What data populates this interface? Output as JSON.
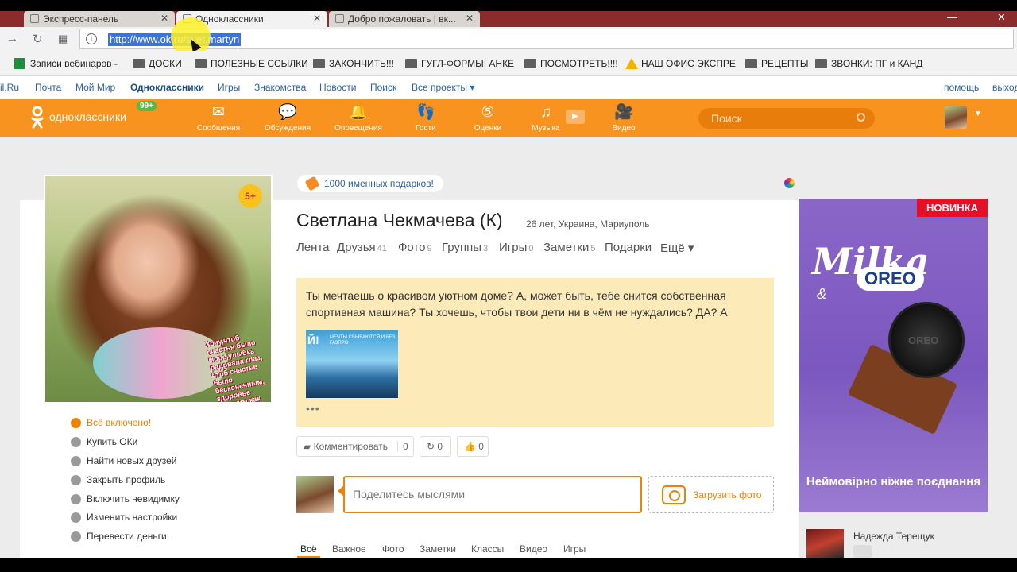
{
  "browser": {
    "tabs": [
      {
        "title": "Экспресс-панель"
      },
      {
        "title": "Одноклассники"
      },
      {
        "title": "Добро пожаловать | вк..."
      }
    ],
    "url": "http://www.ok.ru/svet.martyn",
    "bookmarks": [
      "Записи вебинаров -",
      "ДОСКИ",
      "ПОЛЕЗНЫЕ ССЫЛКИ",
      "ЗАКОНЧИТЬ!!!",
      "ГУГЛ-ФОРМЫ: АНКЕ",
      "ПОСМОТРЕТЬ!!!!",
      "НАШ ОФИС ЭКСПРЕ",
      "РЕЦЕПТЫ",
      "ЗВОНКИ: ПГ и КАНД"
    ]
  },
  "site_nav": {
    "items": [
      "il.Ru",
      "Почта",
      "Мой Мир",
      "Одноклассники",
      "Игры",
      "Знакомства",
      "Новости",
      "Поиск",
      "Все проекты ▾"
    ],
    "help": "помощь",
    "exit": "выход"
  },
  "header": {
    "logo": "одноклассники",
    "badge": "99+",
    "items": [
      {
        "label": "Сообщения",
        "icon": "envelope-icon"
      },
      {
        "label": "Обсуждения",
        "icon": "chat-bubbles-icon"
      },
      {
        "label": "Оповещения",
        "icon": "bell-icon"
      },
      {
        "label": "Гости",
        "icon": "footprints-icon"
      },
      {
        "label": "Оценки",
        "icon": "rating-5-icon"
      },
      {
        "label": "Музыка",
        "icon": "music-note-icon"
      },
      {
        "label": "Видео",
        "icon": "video-camera-icon"
      }
    ],
    "search_placeholder": "Поиск"
  },
  "profile": {
    "age_badge": "5+",
    "photo_poem": "Хочу,чтоб счастья было море,улыбка радовала глаз, чтоб счастье было бесконечным, здоровье крепким как алмаз.",
    "gift_pill": "1000 именных подарков!",
    "name": "Светлана Чекмачева (К)",
    "meta": "26 лет, Украина, Мариуполь",
    "tabs": [
      {
        "label": "Лента",
        "count": ""
      },
      {
        "label": "Друзья",
        "count": "41"
      },
      {
        "label": "Фото",
        "count": "9"
      },
      {
        "label": "Группы",
        "count": "3"
      },
      {
        "label": "Игры",
        "count": "0"
      },
      {
        "label": "Заметки",
        "count": "5"
      },
      {
        "label": "Подарки",
        "count": ""
      },
      {
        "label": "Ещё ▾",
        "count": ""
      }
    ],
    "menu": [
      "Всё включено!",
      "Купить ОКи",
      "Найти новых друзей",
      "Закрыть профиль",
      "Включить невидимку",
      "Изменить настройки",
      "Перевести деньги"
    ]
  },
  "note": {
    "text": "Ты мечтаешь о красивом уютном доме? А, может быть, тебе снится собственная спортивная машина? Ты хочешь, чтобы твои дети ни в чём не нуждались? ДА? А",
    "image_caption": "Й!",
    "image_subcaption": "МЕЧТЫ СБЫВАЮТСЯ И БЕЗ ГАЗПРО",
    "more": "•••"
  },
  "actions": {
    "comment_label": "Комментировать",
    "comment_count": "0",
    "share_count": "0",
    "like_count": "0"
  },
  "composer": {
    "placeholder": "Поделитесь мыслями",
    "upload_label": "Загрузить фото"
  },
  "feed_filters": [
    "Всё",
    "Важное",
    "Фото",
    "Заметки",
    "Классы",
    "Видео",
    "Игры"
  ],
  "ad": {
    "badge": "НОВИНКА",
    "brand": "Milka",
    "amp": "&",
    "partner": "OREO",
    "cookie_text": "OREO",
    "slogan": "Неймовірно ніжне поєднання"
  },
  "friend": {
    "name": "Надежда Терещук"
  }
}
